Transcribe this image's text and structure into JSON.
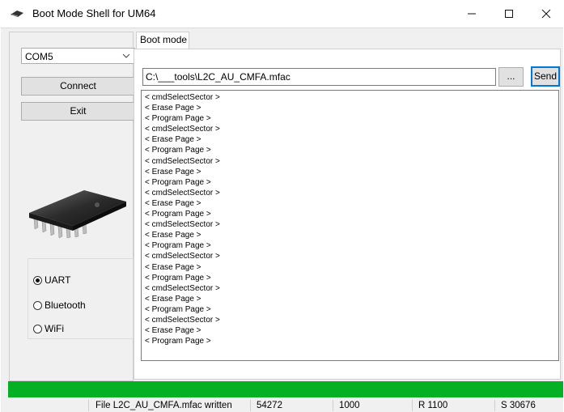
{
  "window": {
    "title": "Boot Mode Shell for UM64"
  },
  "sidebar": {
    "port_value": "COM5",
    "connect_label": "Connect",
    "exit_label": "Exit",
    "radios": [
      {
        "label": "UART",
        "checked": true
      },
      {
        "label": "Bluetooth",
        "checked": false
      },
      {
        "label": "WiFi",
        "checked": false
      }
    ]
  },
  "tabs": [
    {
      "label": "Boot mode",
      "active": true
    }
  ],
  "main": {
    "file_path": "C:\\___tools\\L2C_AU_CMFA.mfac",
    "browse_label": "...",
    "send_label": "Send",
    "log": [
      "< cmdSelectSector >",
      "< Erase Page >",
      "< Program Page >",
      "< cmdSelectSector >",
      "< Erase Page >",
      "< Program Page >",
      "< cmdSelectSector >",
      "< Erase Page >",
      "< Program Page >",
      "< cmdSelectSector >",
      "< Erase Page >",
      "< Program Page >",
      "< cmdSelectSector >",
      "< Erase Page >",
      "< Program Page >",
      "< cmdSelectSector >",
      "< Erase Page >",
      "< Program Page >",
      "< cmdSelectSector >",
      "< Erase Page >",
      "< Program Page >",
      "< cmdSelectSector >",
      "< Erase Page >",
      "< Program Page >"
    ]
  },
  "progress": {
    "percent": 100,
    "color": "#06b025"
  },
  "statusbar": {
    "message": "File L2C_AU_CMFA.mfac written",
    "field1": "54272",
    "field2": "1000",
    "field3": "R 1100",
    "field4": "S 30676"
  }
}
